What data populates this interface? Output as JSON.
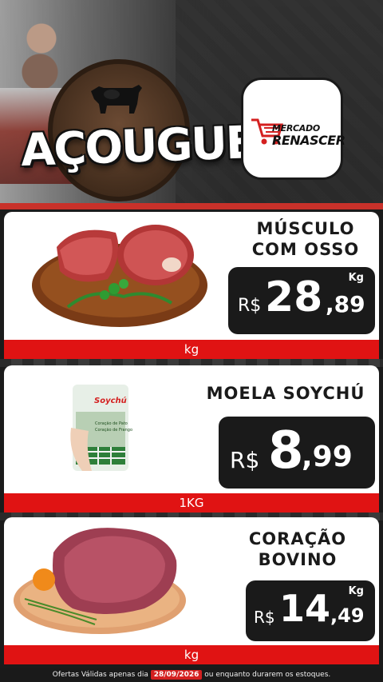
{
  "header": {
    "section_title": "AÇOUGUE",
    "store_logo": {
      "line1": "MERCADO",
      "line2": "RENASCER",
      "icon": "cart-icon"
    }
  },
  "products": [
    {
      "name_line1": "MÚSCULO",
      "name_line2": "COM OSSO",
      "unit_label": "Kg",
      "currency": "R$",
      "price_int": "28",
      "price_dec": ",89",
      "unit_bar": "kg"
    },
    {
      "name_line1": "MOELA SOYCHÚ",
      "currency": "R$",
      "price_int": "8",
      "price_dec": ",99",
      "unit_bar": "1KG",
      "package_brand": "Soychú",
      "package_text1": "Coração de Pato",
      "package_text2": "Coração de Frango"
    },
    {
      "name_line1": "CORAÇÃO",
      "name_line2": "BOVINO",
      "unit_label": "Kg",
      "currency": "R$",
      "price_int": "14",
      "price_dec": ",49",
      "unit_bar": "kg"
    }
  ],
  "footer": {
    "text_before": "Ofertas Válidas apenas dia",
    "date": "28/09/2026",
    "text_after": "ou enquanto durarem os estoques."
  },
  "colors": {
    "accent_red": "#e01313",
    "price_box": "#1a1a1a",
    "card_bg": "#ffffff"
  }
}
